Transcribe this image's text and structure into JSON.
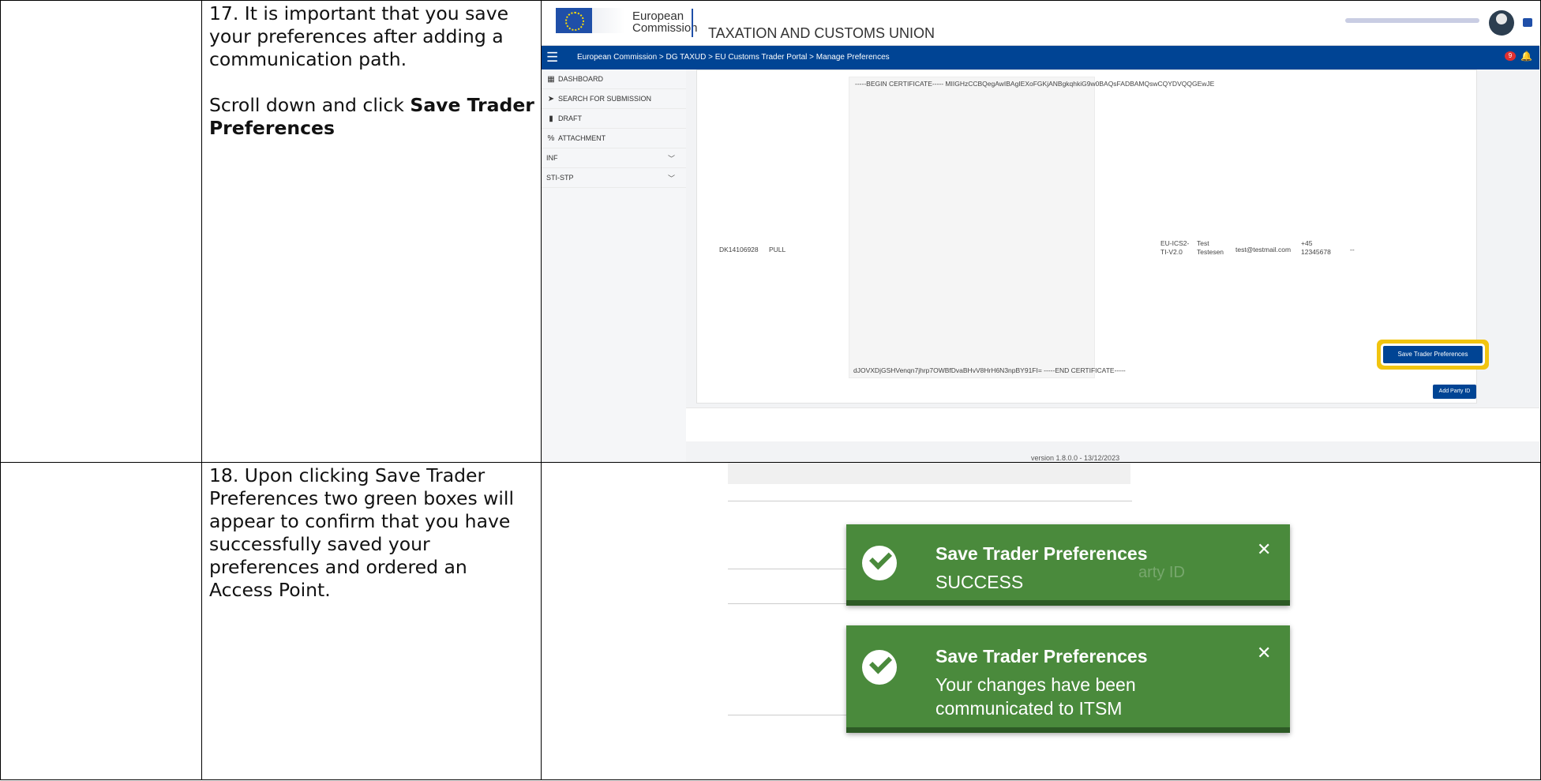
{
  "steps": {
    "s17": {
      "para1": "17. It is important that you save your preferences after adding a communication path.",
      "para2_prefix": "Scroll down and click ",
      "para2_bold": "Save Trader Preferences"
    },
    "s18": {
      "text": "18. Upon clicking Save Trader Preferences two green boxes will appear to confirm that you have successfully saved your preferences and ordered an Access Point."
    }
  },
  "portal": {
    "logo_line1": "European",
    "logo_line2": "Commission",
    "app_title": "TAXATION AND CUSTOMS UNION",
    "breadcrumb": "European Commission > DG TAXUD > EU Customs Trader Portal > Manage Preferences",
    "notification_count": "9",
    "sidebar": [
      {
        "label": "DASHBOARD",
        "icon": "grid-icon",
        "glyph": "▦"
      },
      {
        "label": "SEARCH FOR SUBMISSION",
        "icon": "send-icon",
        "glyph": "➤"
      },
      {
        "label": "DRAFT",
        "icon": "document-icon",
        "glyph": "▮"
      },
      {
        "label": "ATTACHMENT",
        "icon": "link-icon",
        "glyph": "%"
      },
      {
        "label": "INF",
        "icon": "",
        "glyph": ""
      },
      {
        "label": "STI-STP",
        "icon": "",
        "glyph": ""
      }
    ],
    "cert_begin": "-----BEGIN CERTIFICATE----- MIIGHzCCBQegAwIBAgIEXoFGKjANBgkqhkiG9w0BAQsFADBAMQswCQYDVQQGEwJE",
    "cert_end": "dJOVXDjGSHVenqn7jhrp7OWBfDvaBHvV8HrH6N3npBY91FI= -----END CERTIFICATE-----",
    "row": {
      "party_id": "DK14106928",
      "mode": "PULL",
      "profile_1": "EU-ICS2-",
      "profile_2": "TI-V2.0",
      "name_1": "Test",
      "name_2": "Testesen",
      "email": "test@testmail.com",
      "phone_1": "+45",
      "phone_2": "12345678",
      "extra": "--"
    },
    "add_party_label": "Add Party ID",
    "save_label": "Save Trader Preferences",
    "version": "version 1.8.0.0 - 13/12/2023"
  },
  "toasts": [
    {
      "title": "Save Trader Preferences",
      "message": "SUCCESS"
    },
    {
      "title": "Save Trader Preferences",
      "message_1": "Your changes have been",
      "message_2": "communicated to ITSM"
    }
  ],
  "ghost_text": "arty ID",
  "close_glyph": "✕",
  "colors": {
    "accent": "#004494",
    "toast_green": "#4a8a3c",
    "highlight": "#f1c40f"
  }
}
